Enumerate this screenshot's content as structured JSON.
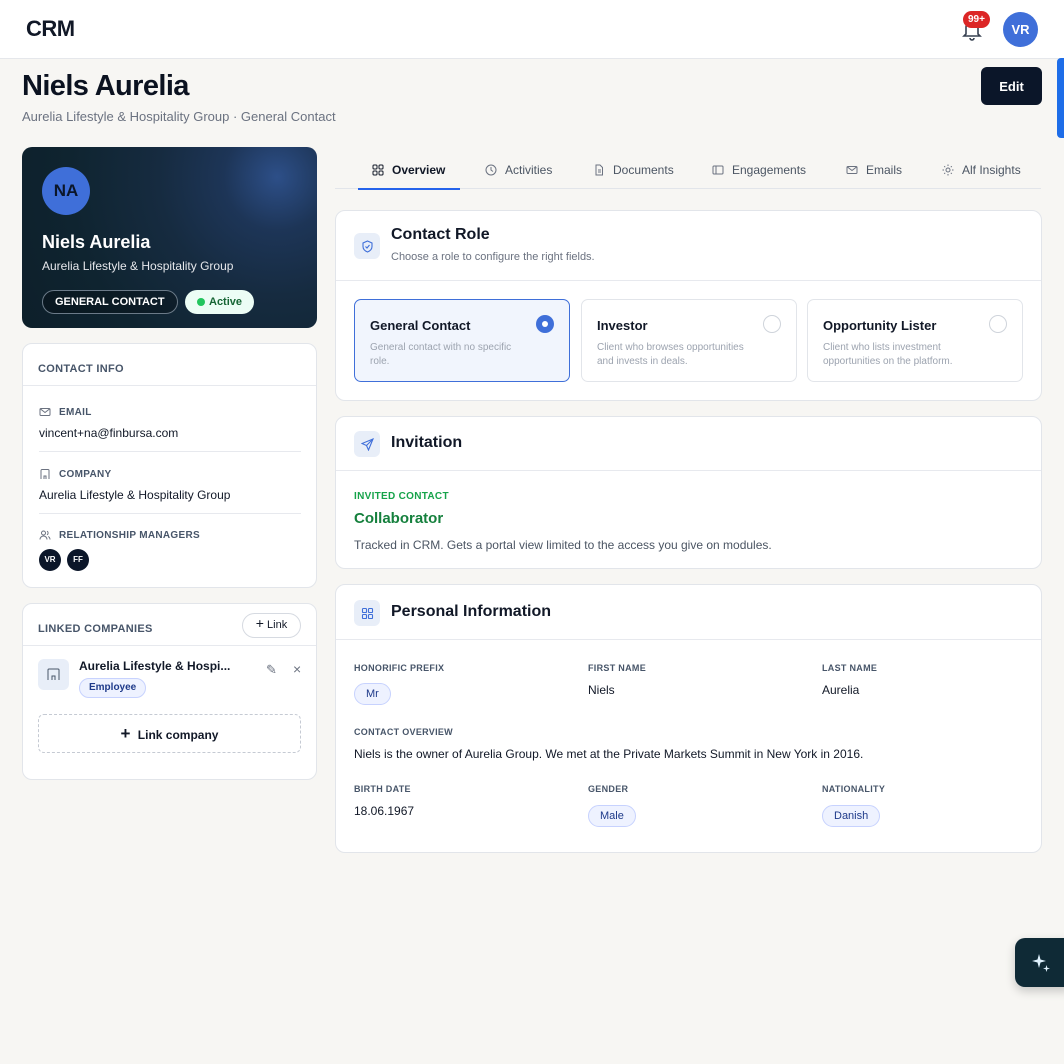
{
  "app": {
    "brand": "CRM",
    "notification_badge": "99+",
    "user_initials": "VR"
  },
  "header": {
    "title": "Niels Aurelia",
    "subtitle": "Aurelia Lifestyle & Hospitality Group · General Contact",
    "edit_label": "Edit"
  },
  "profile": {
    "initials": "NA",
    "name": "Niels Aurelia",
    "company": "Aurelia Lifestyle & Hospitality Group",
    "type_pill": "GENERAL CONTACT",
    "status_pill": "Active"
  },
  "contact_info": {
    "title": "CONTACT INFO",
    "email_label": "EMAIL",
    "email": "vincent+na@finbursa.com",
    "company_label": "COMPANY",
    "company": "Aurelia Lifestyle & Hospitality Group",
    "managers_label": "RELATIONSHIP MANAGERS",
    "managers": [
      "VR",
      "FF"
    ]
  },
  "linked_companies": {
    "title": "LINKED COMPANIES",
    "link_button": "Link",
    "items": [
      {
        "name": "Aurelia Lifestyle & Hospi...",
        "badge": "Employee"
      }
    ],
    "link_company_button": "Link company"
  },
  "tabs": [
    "Overview",
    "Activities",
    "Documents",
    "Engagements",
    "Emails",
    "Alf Insights"
  ],
  "contact_role": {
    "title": "Contact Role",
    "description": "Choose a role to configure the right fields.",
    "options": [
      {
        "name": "General Contact",
        "desc": "General contact with no specific role.",
        "selected": true
      },
      {
        "name": "Investor",
        "desc": "Client who browses opportunities and invests in deals.",
        "selected": false
      },
      {
        "name": "Opportunity Lister",
        "desc": "Client who lists investment opportunities on the platform.",
        "selected": false
      }
    ]
  },
  "invitation": {
    "title": "Invitation",
    "label": "INVITED CONTACT",
    "role": "Collaborator",
    "description": "Tracked in CRM. Gets a portal view limited to the access you give on modules."
  },
  "personal_info": {
    "title": "Personal Information",
    "honorific_label": "HONORIFIC PREFIX",
    "honorific": "Mr",
    "first_name_label": "FIRST NAME",
    "first_name": "Niels",
    "last_name_label": "LAST NAME",
    "last_name": "Aurelia",
    "overview_label": "CONTACT OVERVIEW",
    "overview": "Niels is the owner of Aurelia Group. We met at the Private Markets Summit in New York in 2016.",
    "birth_label": "BIRTH DATE",
    "birth": "18.06.1967",
    "gender_label": "GENDER",
    "gender": "Male",
    "nationality_label": "NATIONALITY",
    "nationality": "Danish"
  },
  "colors": {
    "accent": "#3f6fd9",
    "dark": "#0b1629",
    "success": "#15803d",
    "tab_underline": "#2563eb"
  }
}
